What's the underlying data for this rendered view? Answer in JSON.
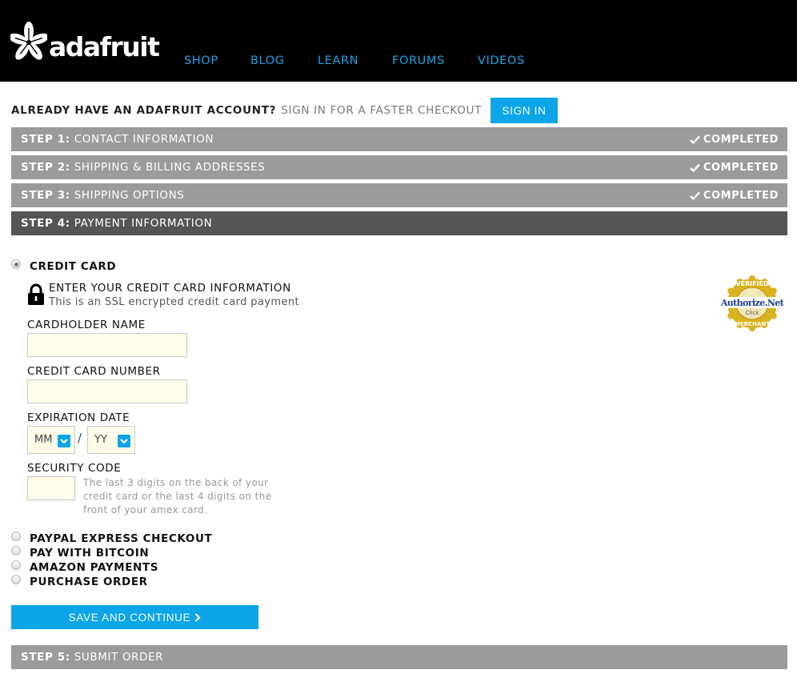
{
  "header": {
    "logo_text": "adafruit",
    "nav": [
      "SHOP",
      "BLOG",
      "LEARN",
      "FORUMS",
      "VIDEOS"
    ]
  },
  "signin": {
    "question": "ALREADY HAVE AN ADAFRUIT ACCOUNT?",
    "hint": "SIGN IN FOR A FASTER CHECKOUT",
    "button": "SIGN IN"
  },
  "steps": [
    {
      "num": "STEP 1:",
      "title": "CONTACT INFORMATION",
      "status": "COMPLETED"
    },
    {
      "num": "STEP 2:",
      "title": "SHIPPING & BILLING ADDRESSES",
      "status": "COMPLETED"
    },
    {
      "num": "STEP 3:",
      "title": "SHIPPING OPTIONS",
      "status": "COMPLETED"
    },
    {
      "num": "STEP 4:",
      "title": "PAYMENT INFORMATION",
      "status": ""
    },
    {
      "num": "STEP 5:",
      "title": "SUBMIT ORDER",
      "status": ""
    }
  ],
  "payment": {
    "credit_card_label": "CREDIT CARD",
    "ssl_title": "ENTER YOUR CREDIT CARD INFORMATION",
    "ssl_subtitle": "This is an SSL encrypted credit card payment",
    "badge": {
      "top": "VERIFIED",
      "brand": "Authorize.Net",
      "click": "Click",
      "bottom": "MERCHANT"
    },
    "cardholder_label": "CARDHOLDER NAME",
    "cardholder_value": "",
    "card_number_label": "CREDIT CARD NUMBER",
    "card_number_value": "",
    "expiration_label": "EXPIRATION DATE",
    "exp_month": "MM",
    "exp_separator": "/",
    "exp_year": "YY",
    "security_label": "SECURITY CODE",
    "security_help": "The last 3 digits on the back of your credit card or the last 4 digits on the front of your amex card.",
    "other_options": [
      "PAYPAL EXPRESS CHECKOUT",
      "PAY WITH BITCOIN",
      "AMAZON PAYMENTS",
      "PURCHASE ORDER"
    ],
    "save_button": "SAVE AND CONTINUE"
  },
  "colors": {
    "accent": "#0ba5e8",
    "nav_link": "#1ea1e6",
    "step_bg": "#9b9b9b",
    "step_active_bg": "#555555",
    "input_bg": "#fffde9"
  }
}
